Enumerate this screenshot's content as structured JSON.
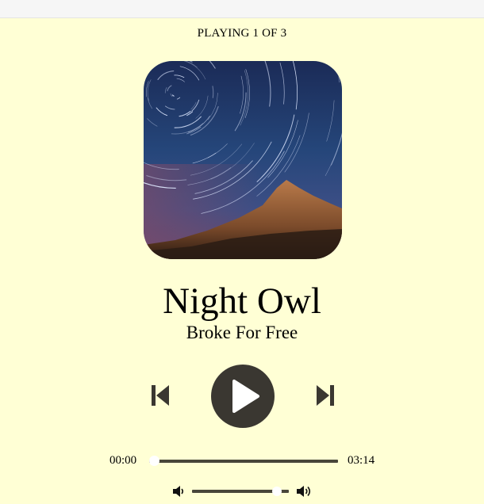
{
  "player": {
    "status": "PLAYING 1 OF 3",
    "track_title": "Night Owl",
    "artist": "Broke For Free",
    "current_time": "00:00",
    "duration": "03:14",
    "progress": 0.0,
    "volume": 0.92
  },
  "colors": {
    "background": "#ffffd5",
    "controls": "#3a3731",
    "track": "#48463a"
  },
  "icons": {
    "prev": "skip-previous-icon",
    "play": "play-icon",
    "next": "skip-next-icon",
    "volume_down": "volume-down-icon",
    "volume_up": "volume-up-icon"
  }
}
